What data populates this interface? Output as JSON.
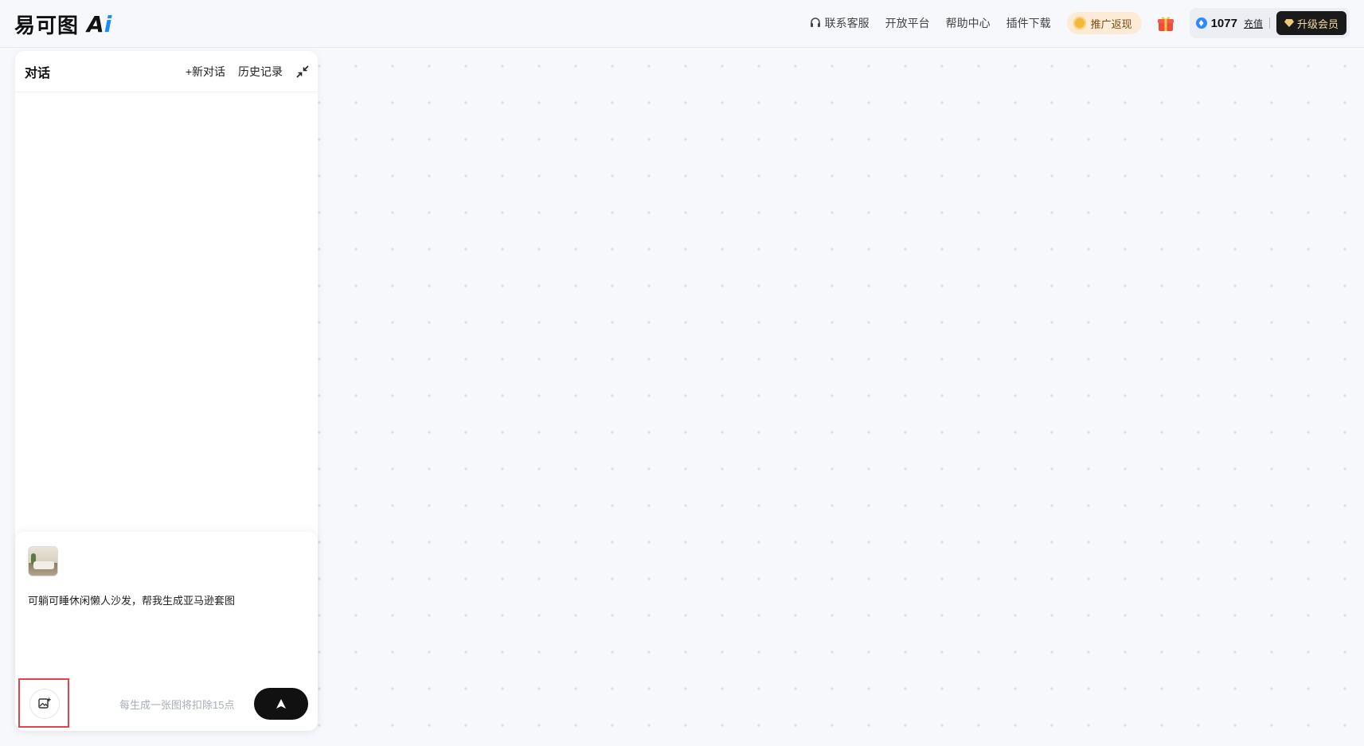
{
  "header": {
    "logo_text": "易可图",
    "logo_ai": "A",
    "logo_ai_i": "i",
    "nav": {
      "contact": "联系客服",
      "open_platform": "开放平台",
      "help_center": "帮助中心",
      "plugin_download": "插件下载"
    },
    "promo_label": "推广返现",
    "points": "1077",
    "recharge": "充值",
    "upgrade": "升级会员"
  },
  "chat": {
    "title": "对话",
    "new_chat": "+新对话",
    "history": "历史记录",
    "prompt": "可躺可睡休闲懒人沙发，帮我生成亚马逊套图",
    "hint": "每生成一张图将扣除15点"
  },
  "colors": {
    "background": "#f7f8fc",
    "accent_blue": "#1a8cff",
    "send_button": "#111111",
    "promo_bg": "#fdebd5",
    "highlight_box": "#e0454b",
    "vip_text": "#f3d9a4"
  },
  "icons": {
    "contact": "headset-icon",
    "promo": "coin-icon",
    "gift": "gift-icon",
    "points": "gem-icon",
    "upgrade": "diamond-icon",
    "collapse": "collapse-icon",
    "upload": "image-add-icon",
    "send": "send-arrow-icon"
  }
}
